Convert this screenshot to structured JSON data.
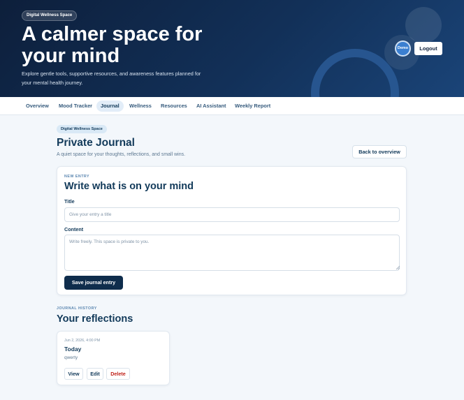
{
  "hero": {
    "badge": "Digital Wellness Space",
    "title": "A calmer space for your mind",
    "subtitle": "Explore gentle tools, supportive resources, and awareness features planned for your mental health journey.",
    "avatar_label": "Demo",
    "logout_label": "Logout"
  },
  "nav": {
    "items": [
      {
        "label": "Overview"
      },
      {
        "label": "Mood Tracker"
      },
      {
        "label": "Journal",
        "active": true
      },
      {
        "label": "Wellness"
      },
      {
        "label": "Resources"
      },
      {
        "label": "AI Assistant"
      },
      {
        "label": "Weekly Report"
      }
    ]
  },
  "page": {
    "pill": "Digital Wellness Space",
    "title": "Private Journal",
    "subtitle": "A quiet space for your thoughts, reflections, and small wins.",
    "back_label": "Back to overview"
  },
  "entry": {
    "eyebrow": "NEW ENTRY",
    "title": "Write what is on your mind",
    "title_label": "Title",
    "title_placeholder": "Give your entry a title",
    "title_value": "",
    "content_label": "Content",
    "content_placeholder": "Write freely. This space is private to you.",
    "content_value": "",
    "save_label": "Save journal entry"
  },
  "history": {
    "eyebrow": "JOURNAL HISTORY",
    "title": "Your reflections",
    "entries": [
      {
        "date": "Jun 2, 2026, 4:00 PM",
        "title": "Today",
        "body": "qwerty",
        "view_label": "View",
        "edit_label": "Edit",
        "delete_label": "Delete"
      }
    ]
  },
  "colors": {
    "hero_bg": "#0d1f3b",
    "primary": "#0f2d4c",
    "accent": "#3b7fd0",
    "danger": "#c0231b",
    "page_bg": "#f3f7fb"
  }
}
